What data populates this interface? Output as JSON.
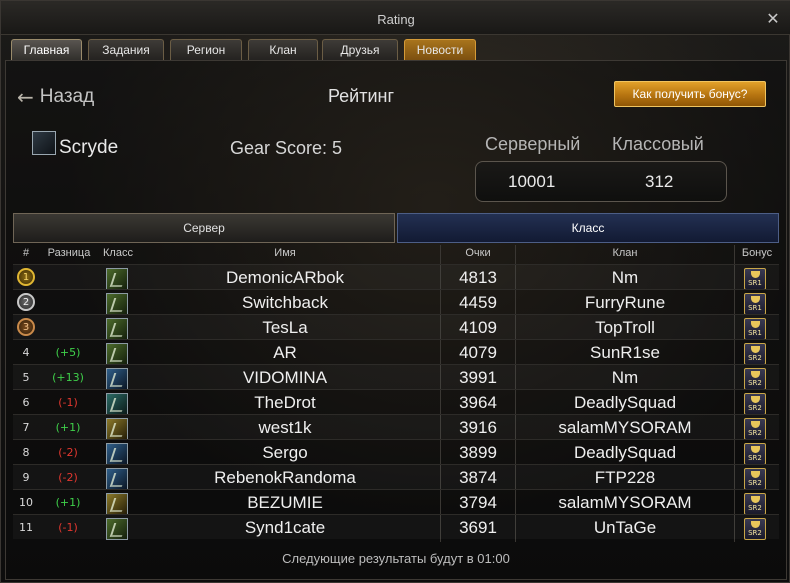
{
  "window": {
    "title": "Rating",
    "close_icon": "close-icon"
  },
  "tabs": [
    {
      "label": "Главная",
      "active": true
    },
    {
      "label": "Задания",
      "active": false
    },
    {
      "label": "Регион",
      "active": false
    },
    {
      "label": "Клан",
      "active": false
    },
    {
      "label": "Друзья",
      "active": false
    },
    {
      "label": "Новости",
      "active": false,
      "highlight": "#b67410"
    }
  ],
  "header": {
    "back_label": "Назад",
    "page_title": "Рейтинг",
    "bonus_button": "Как получить бонус?"
  },
  "profile": {
    "name": "Scryde",
    "gear_score": "Gear Score: 5",
    "server_rank_label": "Серверный",
    "class_rank_label": "Классовый",
    "server_rank": "10001",
    "class_rank": "312"
  },
  "subtabs": {
    "server": "Сервер",
    "class": "Класс",
    "active": "class"
  },
  "table": {
    "headers": {
      "rank": "#",
      "diff": "Разница",
      "class": "Класс",
      "name": "Имя",
      "points": "Очки",
      "clan": "Клан",
      "bonus": "Бонус"
    },
    "rows": [
      {
        "rank": "1",
        "medal": "gold",
        "diff": "",
        "class_color": "green",
        "name": "DemonicARbok",
        "points": "4813",
        "clan": "Nm",
        "bonus": "SR1"
      },
      {
        "rank": "2",
        "medal": "silver",
        "diff": "",
        "class_color": "green",
        "name": "Switchback",
        "points": "4459",
        "clan": "FurryRune",
        "bonus": "SR1"
      },
      {
        "rank": "3",
        "medal": "bronze",
        "diff": "",
        "class_color": "green",
        "name": "TesLa",
        "points": "4109",
        "clan": "TopTroll",
        "bonus": "SR1"
      },
      {
        "rank": "4",
        "medal": "",
        "diff": "(+5)",
        "diff_dir": "up",
        "class_color": "green",
        "name": "AR",
        "points": "4079",
        "clan": "SunR1se",
        "bonus": "SR2"
      },
      {
        "rank": "5",
        "medal": "",
        "diff": "(+13)",
        "diff_dir": "up",
        "class_color": "blue",
        "name": "VIDOMINA",
        "points": "3991",
        "clan": "Nm",
        "bonus": "SR2"
      },
      {
        "rank": "6",
        "medal": "",
        "diff": "(-1)",
        "diff_dir": "down",
        "class_color": "teal",
        "name": "TheDrot",
        "points": "3964",
        "clan": "DeadlySquad",
        "bonus": "SR2"
      },
      {
        "rank": "7",
        "medal": "",
        "diff": "(+1)",
        "diff_dir": "up",
        "class_color": "gold",
        "name": "west1k",
        "points": "3916",
        "clan": "salamMYSORAM",
        "bonus": "SR2"
      },
      {
        "rank": "8",
        "medal": "",
        "diff": "(-2)",
        "diff_dir": "down",
        "class_color": "blue",
        "name": "Sergo",
        "points": "3899",
        "clan": "DeadlySquad",
        "bonus": "SR2"
      },
      {
        "rank": "9",
        "medal": "",
        "diff": "(-2)",
        "diff_dir": "down",
        "class_color": "blue",
        "name": "RebenokRandoma",
        "points": "3874",
        "clan": "FTP228",
        "bonus": "SR2"
      },
      {
        "rank": "10",
        "medal": "",
        "diff": "(+1)",
        "diff_dir": "up",
        "class_color": "gold",
        "name": "BEZUMIE",
        "points": "3794",
        "clan": "salamMYSORAM",
        "bonus": "SR2"
      },
      {
        "rank": "11",
        "medal": "",
        "diff": "(-1)",
        "diff_dir": "down",
        "class_color": "green",
        "name": "Synd1cate",
        "points": "3691",
        "clan": "UnTaGe",
        "bonus": "SR2"
      }
    ]
  },
  "footer": {
    "next_results": "Следующие результаты будут в 01:00"
  }
}
